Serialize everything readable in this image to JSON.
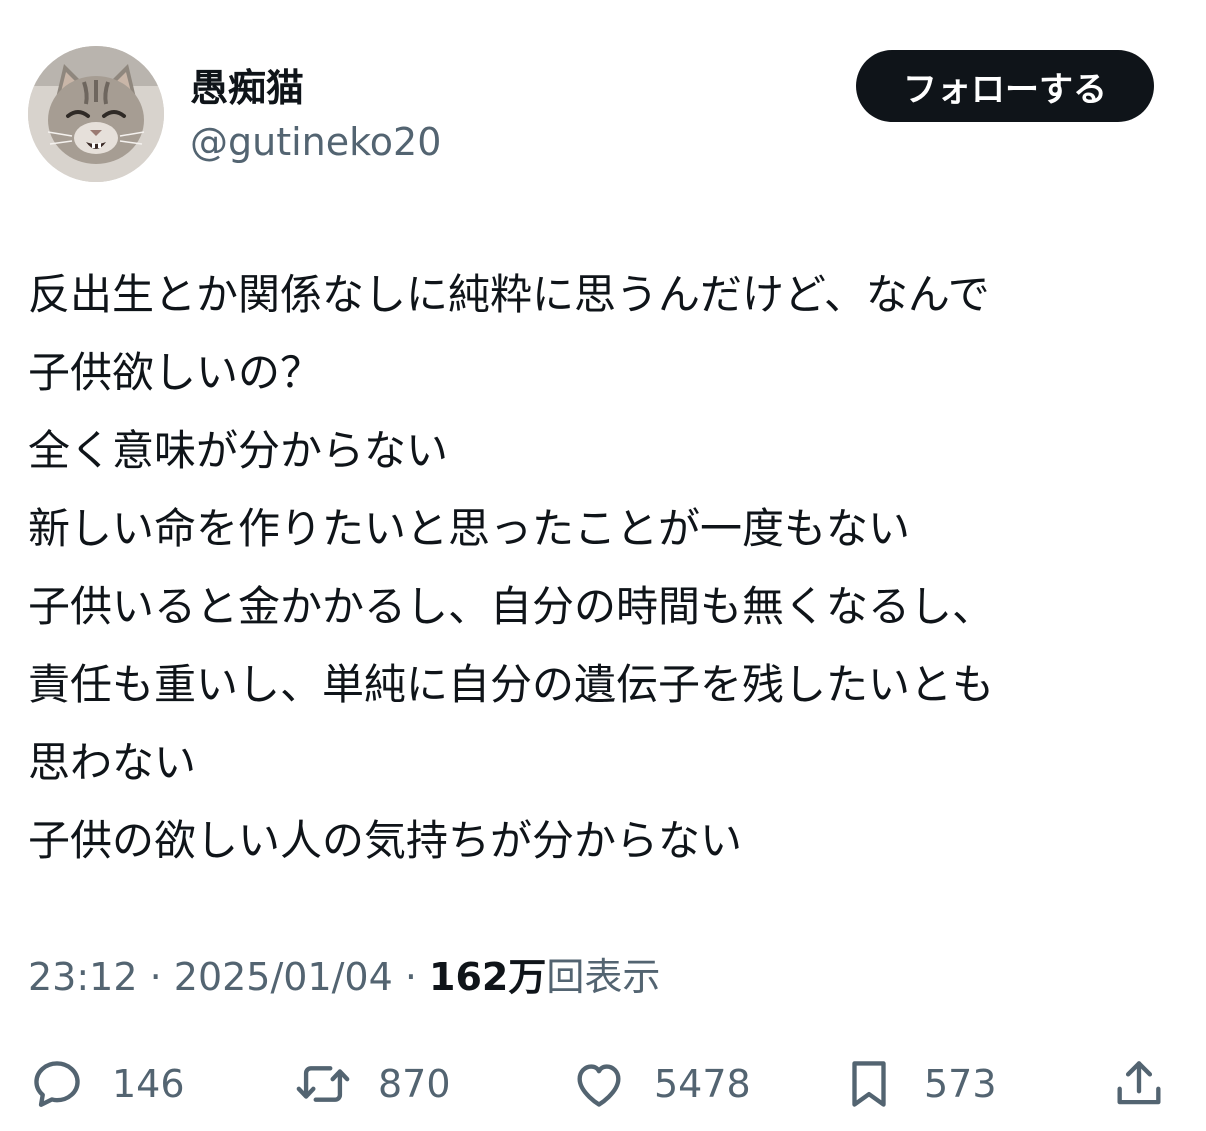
{
  "user": {
    "display_name": "愚痴猫",
    "handle": "@gutineko20",
    "avatar_icon": "cat-avatar"
  },
  "follow_button": {
    "label": "フォローする"
  },
  "tweet": {
    "lines": [
      "反出生とか関係なしに純粋に思うんだけど、なんで",
      "子供欲しいの？",
      "全く意味が分からない",
      "新しい命を作りたいと思ったことが一度もない",
      "子供いると金かかるし、自分の時間も無くなるし、",
      "責任も重いし、単純に自分の遺伝子を残したいとも",
      "思わない",
      "子供の欲しい人の気持ちが分からない"
    ]
  },
  "meta": {
    "time": "23:12",
    "separator": " · ",
    "date": "2025/01/04",
    "views_count": "162万",
    "views_label": "回表示"
  },
  "actions": {
    "reply": {
      "icon": "reply-icon",
      "count": "146"
    },
    "retweet": {
      "icon": "retweet-icon",
      "count": "870"
    },
    "like": {
      "icon": "heart-icon",
      "count": "5478"
    },
    "bookmark": {
      "icon": "bookmark-icon",
      "count": "573"
    },
    "share": {
      "icon": "share-icon"
    }
  },
  "colors": {
    "text_primary": "#0f1419",
    "text_secondary": "#536471",
    "button_bg": "#0f1419",
    "button_text": "#ffffff",
    "background": "#ffffff"
  }
}
